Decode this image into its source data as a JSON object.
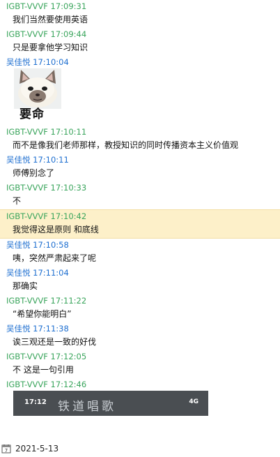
{
  "messages": [
    {
      "sender": "IGBT-VVVF",
      "time": "17:09:31",
      "text": "我们当然要使用英语"
    },
    {
      "sender": "IGBT-VVVF",
      "time": "17:09:44",
      "text": "只是要拿他学习知识"
    },
    {
      "sender": "吴佳悦",
      "time": "17:10:04",
      "sticker_caption": "要命",
      "sticker_icon": "cat-sticker-icon"
    },
    {
      "sender": "IGBT-VVVF",
      "time": "17:10:11",
      "text": "而不是像我们老师那样，教授知识的同时传播资本主义价值观"
    },
    {
      "sender": "吴佳悦",
      "time": "17:10:11",
      "text": "师傅别念了"
    },
    {
      "sender": "IGBT-VVVF",
      "time": "17:10:33",
      "text": "不"
    },
    {
      "sender": "IGBT-VVVF",
      "time": "17:10:42",
      "text": "我觉得这是原则 和底线"
    },
    {
      "sender": "吴佳悦",
      "time": "17:10:58",
      "text": "咦，突然严肃起来了呢"
    },
    {
      "sender": "吴佳悦",
      "time": "17:11:04",
      "text": "那确实"
    },
    {
      "sender": "IGBT-VVVF",
      "time": "17:11:22",
      "text": "“希望你能明白”"
    },
    {
      "sender": "吴佳悦",
      "time": "17:11:38",
      "text": "诶三观还是一致的好伐"
    },
    {
      "sender": "IGBT-VVVF",
      "time": "17:12:05",
      "text": "不 这是一句引用"
    },
    {
      "sender": "IGBT-VVVF",
      "time": "17:12:46",
      "screenshot": {
        "time": "17:12",
        "title": "铁道唱歌",
        "status": "4G"
      }
    }
  ],
  "colors": {
    "sender_green": "#3aa55c",
    "sender_blue": "#1e6fd0",
    "highlight_bg": "#fdf0c9"
  },
  "footer": {
    "date": "2021-5-13",
    "icon": "calendar-icon"
  }
}
